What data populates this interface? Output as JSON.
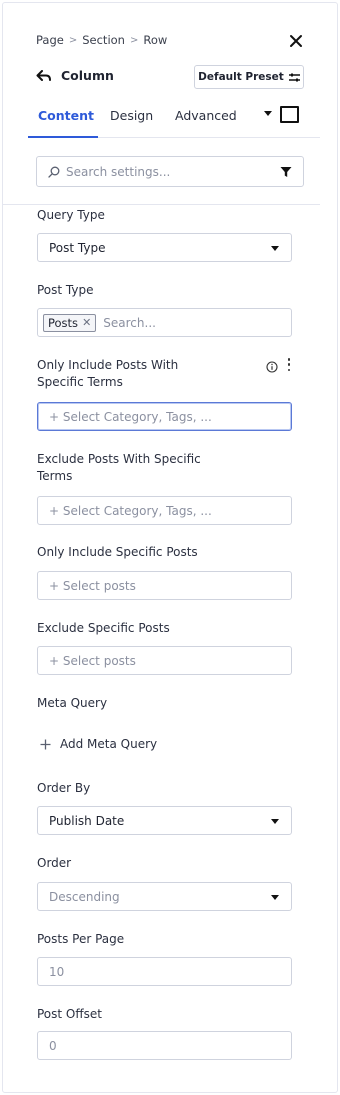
{
  "breadcrumb": [
    "Page",
    "Section",
    "Row"
  ],
  "header": {
    "back_label": "Column",
    "preset_label": "Default Preset"
  },
  "tabs": [
    {
      "label": "Content",
      "active": true
    },
    {
      "label": "Design",
      "active": false
    },
    {
      "label": "Advanced",
      "active": false
    }
  ],
  "search": {
    "placeholder": "Search settings..."
  },
  "fields": {
    "query_type": {
      "label": "Query Type",
      "value": "Post Type"
    },
    "post_type": {
      "label": "Post Type",
      "tag": "Posts",
      "placeholder": "Search..."
    },
    "include_terms": {
      "label_line1": "Only Include Posts With",
      "label_line2": "Specific Terms",
      "placeholder": "+ Select Category, Tags, ..."
    },
    "exclude_terms": {
      "label_line1": "Exclude Posts With Specific",
      "label_line2": "Terms",
      "placeholder": "+ Select Category, Tags, ..."
    },
    "include_posts": {
      "label": "Only Include Specific Posts",
      "placeholder": "+ Select posts"
    },
    "exclude_posts": {
      "label": "Exclude Specific Posts",
      "placeholder": "+ Select posts"
    },
    "meta_query": {
      "label": "Meta Query",
      "add_label": "Add Meta Query"
    },
    "order_by": {
      "label": "Order By",
      "value": "Publish Date"
    },
    "order": {
      "label": "Order",
      "value": "Descending"
    },
    "posts_per_page": {
      "label": "Posts Per Page",
      "value": "10"
    },
    "post_offset": {
      "label": "Post Offset",
      "value": "0"
    }
  },
  "colors": {
    "accent": "#2e5ad9",
    "border": "#cfd3de",
    "muted_text": "#8b90a0"
  },
  "icons": [
    "close-icon",
    "back-arrow-icon",
    "preset-icon",
    "caret-down-icon",
    "square-icon",
    "search-icon",
    "filter-icon",
    "info-icon",
    "kebab-icon",
    "plus-icon"
  ]
}
